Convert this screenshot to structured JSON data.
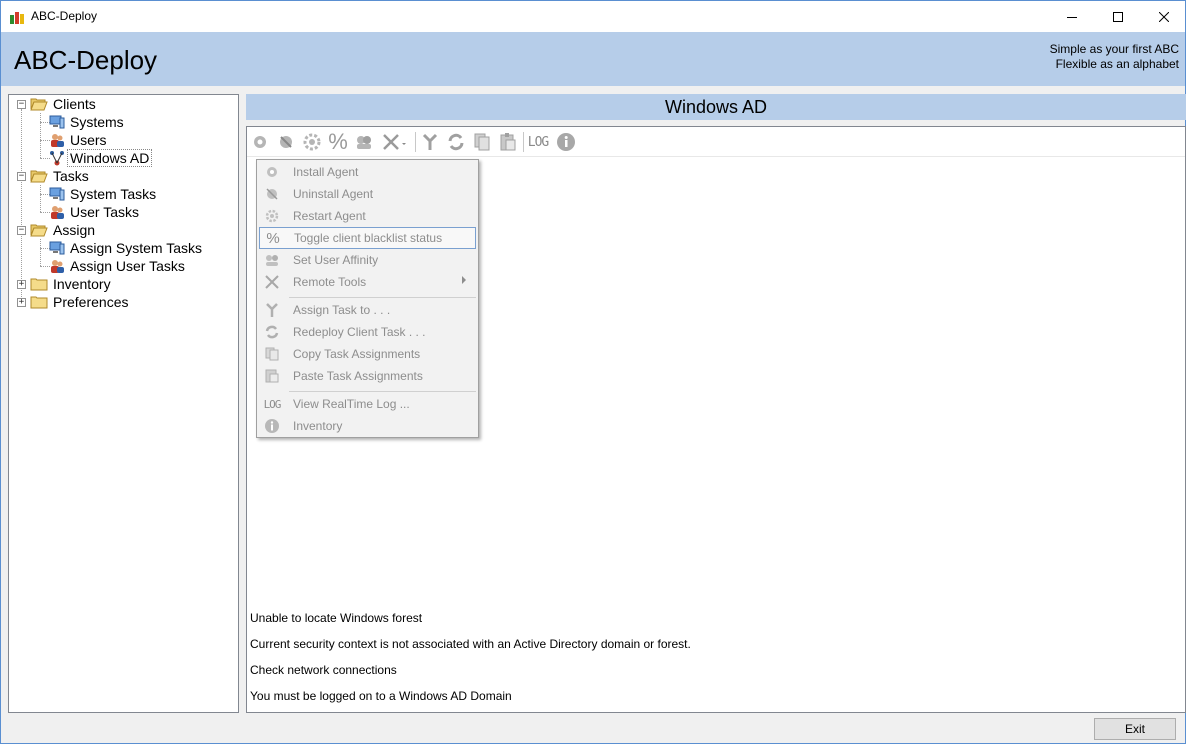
{
  "window": {
    "title": "ABC-Deploy"
  },
  "header": {
    "brand": "ABC-Deploy",
    "slogan_line1": "Simple as your first ABC",
    "slogan_line2": "Flexible as an alphabet"
  },
  "tree": {
    "clients": "Clients",
    "systems": "Systems",
    "users": "Users",
    "windows_ad": "Windows AD",
    "tasks": "Tasks",
    "system_tasks": "System Tasks",
    "user_tasks": "User Tasks",
    "assign": "Assign",
    "assign_system_tasks": "Assign System Tasks",
    "assign_user_tasks": "Assign User Tasks",
    "inventory": "Inventory",
    "preferences": "Preferences"
  },
  "panel": {
    "title": "Windows AD"
  },
  "toolbar": {
    "log_label": "LOG",
    "percent_label": "%"
  },
  "menu": {
    "install_agent": "Install Agent",
    "uninstall_agent": "Uninstall Agent",
    "restart_agent": "Restart Agent",
    "toggle_blacklist": "Toggle client blacklist status",
    "set_user_affinity": "Set User Affinity",
    "remote_tools": "Remote Tools",
    "assign_task": "Assign Task to . . .",
    "redeploy_task": "Redeploy Client Task . . .",
    "copy_assignments": "Copy Task Assignments",
    "paste_assignments": "Paste Task Assignments",
    "view_log": "View RealTime Log ...",
    "inventory": "Inventory",
    "log_icon_text": "LOG",
    "percent_icon_text": "%"
  },
  "messages": {
    "line1": "Unable to locate Windows forest",
    "line2": "Current security context is not associated with an Active Directory domain or forest.",
    "line3": "Check network connections",
    "line4": "You must be logged on to a Windows AD Domain"
  },
  "buttons": {
    "exit": "Exit"
  },
  "colors": {
    "header_bg": "#b6cde9",
    "menu_text_disabled": "#8d8d8d",
    "window_border": "#5a8fd1"
  }
}
